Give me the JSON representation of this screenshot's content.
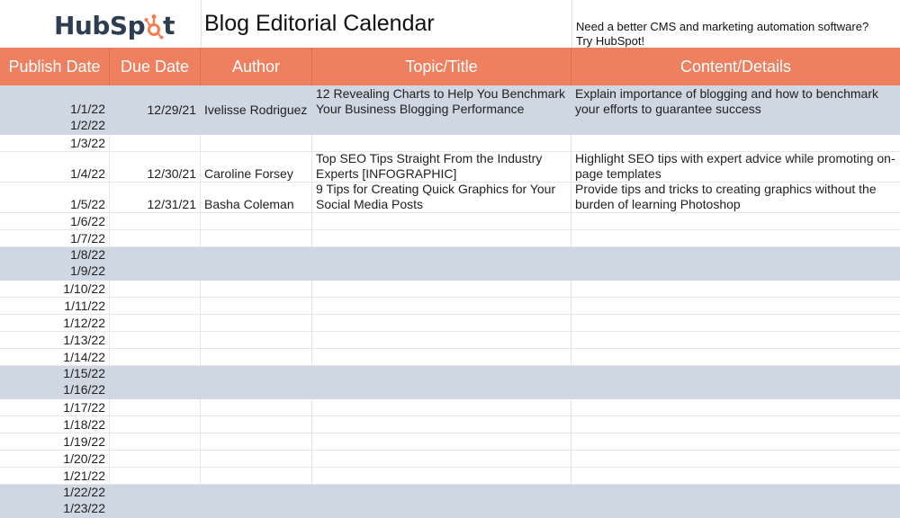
{
  "brand": {
    "logo_text_left": "HubSp",
    "logo_text_right": "t",
    "logo_accent": "#f57c4f",
    "logo_color": "#2d3e50"
  },
  "title": "Blog Editorial Calendar",
  "promo": {
    "line1": "Need a better CMS and marketing automation software?",
    "line2": "Try HubSpot!"
  },
  "colors": {
    "header_bg": "#ee7f5f",
    "weekend_bg": "#cfd7e2"
  },
  "columns": [
    "Publish Date",
    "Due Date",
    "Author",
    "Topic/Title",
    "Content/Details"
  ],
  "rows": [
    {
      "weekend": true,
      "publish": [
        "1/1/22",
        "1/2/22"
      ],
      "due": "12/29/21",
      "author": "Ivelisse Rodriguez",
      "topic": "12 Revealing Charts to Help You Benchmark Your Business Blogging Performance",
      "details": "Explain importance of blogging and how to benchmark your efforts to guarantee success"
    },
    {
      "weekend": false,
      "publish": [
        "1/3/22"
      ],
      "due": "",
      "author": "",
      "topic": "",
      "details": ""
    },
    {
      "weekend": false,
      "publish": [
        "1/4/22"
      ],
      "due": "12/30/21",
      "author": "Caroline Forsey",
      "topic": "Top SEO Tips Straight From the Industry Experts [INFOGRAPHIC]",
      "details": "Highlight SEO tips with expert advice while promoting on-page templates"
    },
    {
      "weekend": false,
      "publish": [
        "1/5/22"
      ],
      "due": "12/31/21",
      "author": "Basha Coleman",
      "topic": "9 Tips for Creating Quick Graphics for Your Social Media Posts",
      "details": "Provide tips and tricks to creating graphics without the burden of learning Photoshop"
    },
    {
      "weekend": false,
      "publish": [
        "1/6/22"
      ],
      "due": "",
      "author": "",
      "topic": "",
      "details": ""
    },
    {
      "weekend": false,
      "publish": [
        "1/7/22"
      ],
      "due": "",
      "author": "",
      "topic": "",
      "details": ""
    },
    {
      "weekend": true,
      "publish": [
        "1/8/22",
        "1/9/22"
      ],
      "due": "",
      "author": "",
      "topic": "",
      "details": ""
    },
    {
      "weekend": false,
      "publish": [
        "1/10/22"
      ],
      "due": "",
      "author": "",
      "topic": "",
      "details": ""
    },
    {
      "weekend": false,
      "publish": [
        "1/11/22"
      ],
      "due": "",
      "author": "",
      "topic": "",
      "details": ""
    },
    {
      "weekend": false,
      "publish": [
        "1/12/22"
      ],
      "due": "",
      "author": "",
      "topic": "",
      "details": ""
    },
    {
      "weekend": false,
      "publish": [
        "1/13/22"
      ],
      "due": "",
      "author": "",
      "topic": "",
      "details": ""
    },
    {
      "weekend": false,
      "publish": [
        "1/14/22"
      ],
      "due": "",
      "author": "",
      "topic": "",
      "details": ""
    },
    {
      "weekend": true,
      "publish": [
        "1/15/22",
        "1/16/22"
      ],
      "due": "",
      "author": "",
      "topic": "",
      "details": ""
    },
    {
      "weekend": false,
      "publish": [
        "1/17/22"
      ],
      "due": "",
      "author": "",
      "topic": "",
      "details": ""
    },
    {
      "weekend": false,
      "publish": [
        "1/18/22"
      ],
      "due": "",
      "author": "",
      "topic": "",
      "details": ""
    },
    {
      "weekend": false,
      "publish": [
        "1/19/22"
      ],
      "due": "",
      "author": "",
      "topic": "",
      "details": ""
    },
    {
      "weekend": false,
      "publish": [
        "1/20/22"
      ],
      "due": "",
      "author": "",
      "topic": "",
      "details": ""
    },
    {
      "weekend": false,
      "publish": [
        "1/21/22"
      ],
      "due": "",
      "author": "",
      "topic": "",
      "details": ""
    },
    {
      "weekend": true,
      "publish": [
        "1/22/22",
        "1/23/22"
      ],
      "due": "",
      "author": "",
      "topic": "",
      "details": ""
    }
  ]
}
